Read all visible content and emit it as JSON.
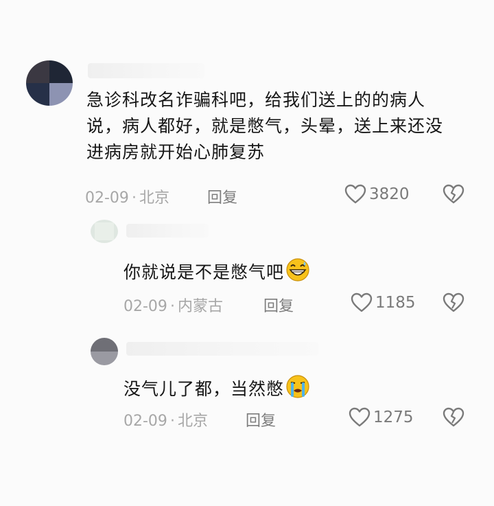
{
  "comments": [
    {
      "text": "急诊科改名诈骗科吧，给我们送上的的病人说，病人都好，就是憋气，头晕，送上来还没进病房就开始心肺复苏",
      "date": "02-09",
      "location": "北京",
      "reply_label": "回复",
      "likes": "3820",
      "emoji": ""
    },
    {
      "text": "你就说是不是憋气吧",
      "date": "02-09",
      "location": "内蒙古",
      "reply_label": "回复",
      "likes": "1185",
      "emoji": "grinning-sweat-emoji"
    },
    {
      "text": "没气儿了都，当然憋",
      "date": "02-09",
      "location": "北京",
      "reply_label": "回复",
      "likes": "1275",
      "emoji": "crying-emoji"
    }
  ],
  "colors": {
    "text": "#161616",
    "meta": "#a7a7a7",
    "icon": "#7a7a7a",
    "emoji_face": "#f7c21b"
  }
}
